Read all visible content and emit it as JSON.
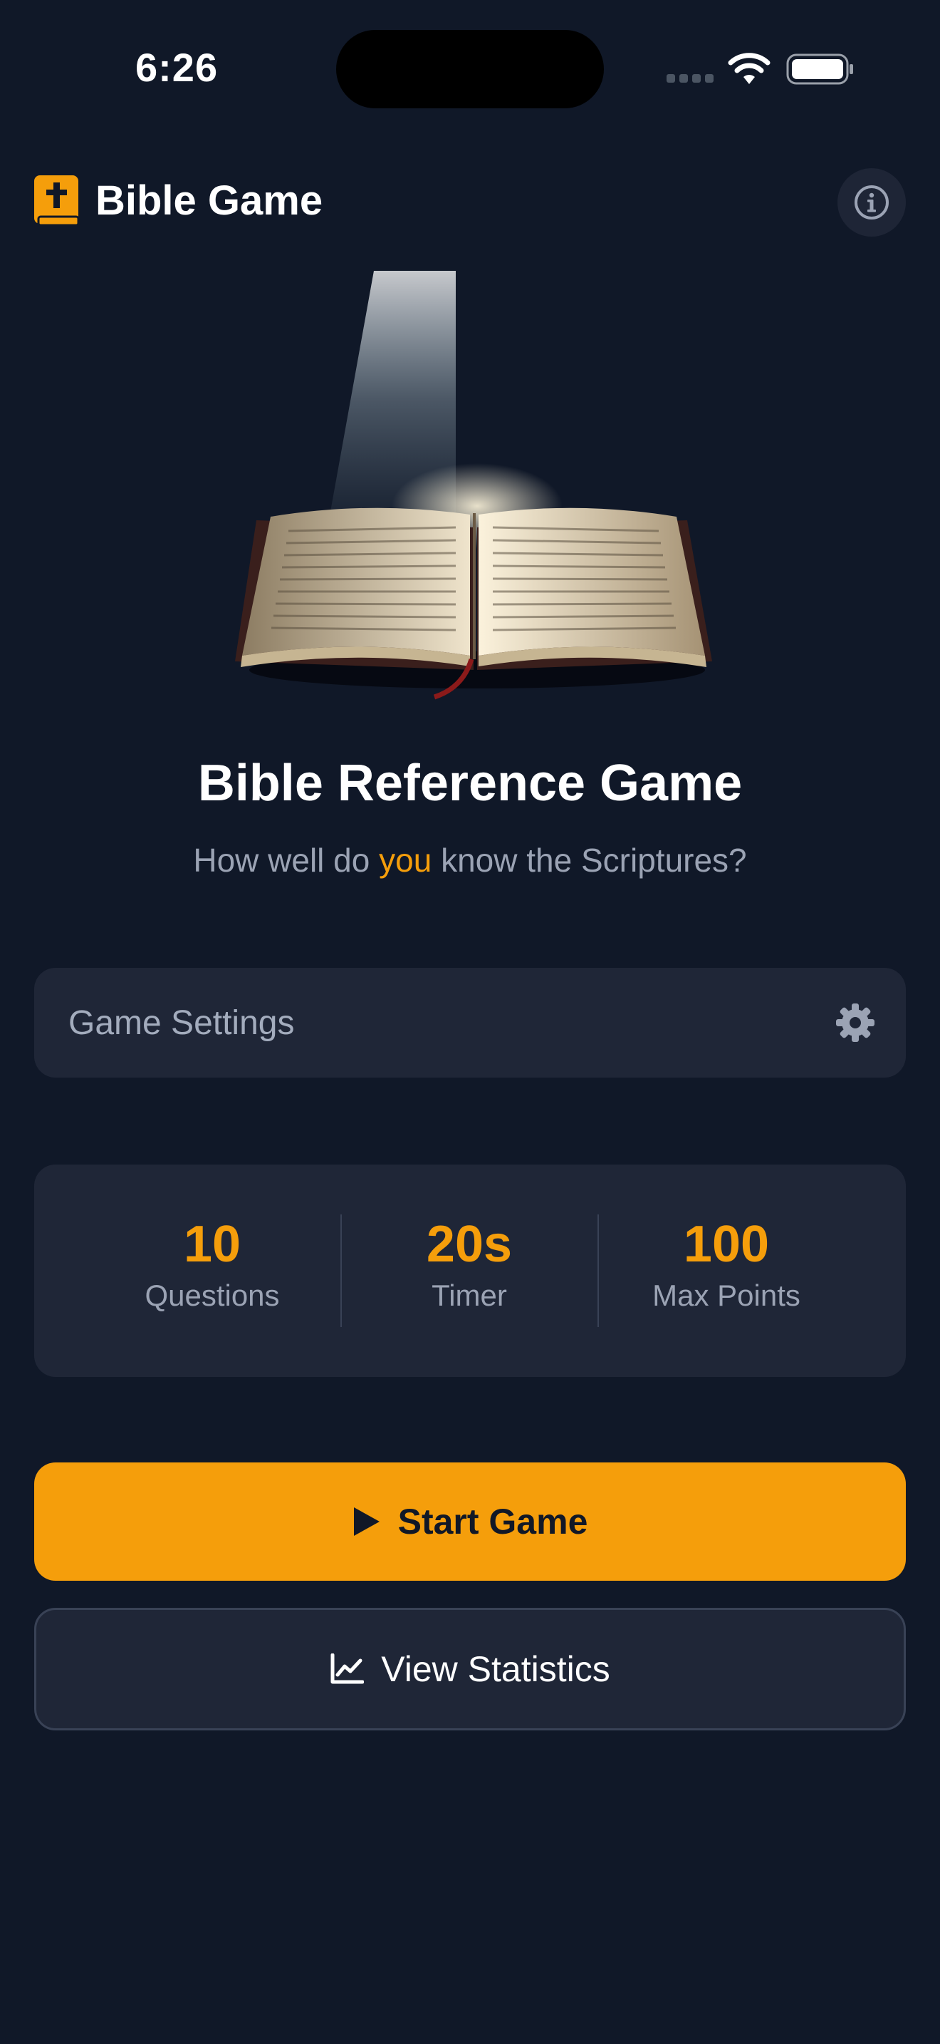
{
  "status_bar": {
    "time": "6:26"
  },
  "header": {
    "title": "Bible Game"
  },
  "hero": {
    "title": "Bible Reference Game",
    "subtitle_before": "How well do ",
    "subtitle_accent": "you",
    "subtitle_after": " know the Scriptures?"
  },
  "settings": {
    "label": "Game Settings"
  },
  "stats": [
    {
      "value": "10",
      "label": "Questions"
    },
    {
      "value": "20s",
      "label": "Timer"
    },
    {
      "value": "100",
      "label": "Max Points"
    }
  ],
  "actions": {
    "start_label": "Start Game",
    "statistics_label": "View Statistics"
  },
  "icons": {
    "logo": "bible-cross-icon",
    "info": "info-icon",
    "settings": "gear-icon",
    "start": "play-icon",
    "statistics": "chart-line-icon"
  },
  "colors": {
    "background": "#101828",
    "card": "#1f2637",
    "accent": "#f59e0b",
    "muted_text": "#9ba3b4"
  }
}
